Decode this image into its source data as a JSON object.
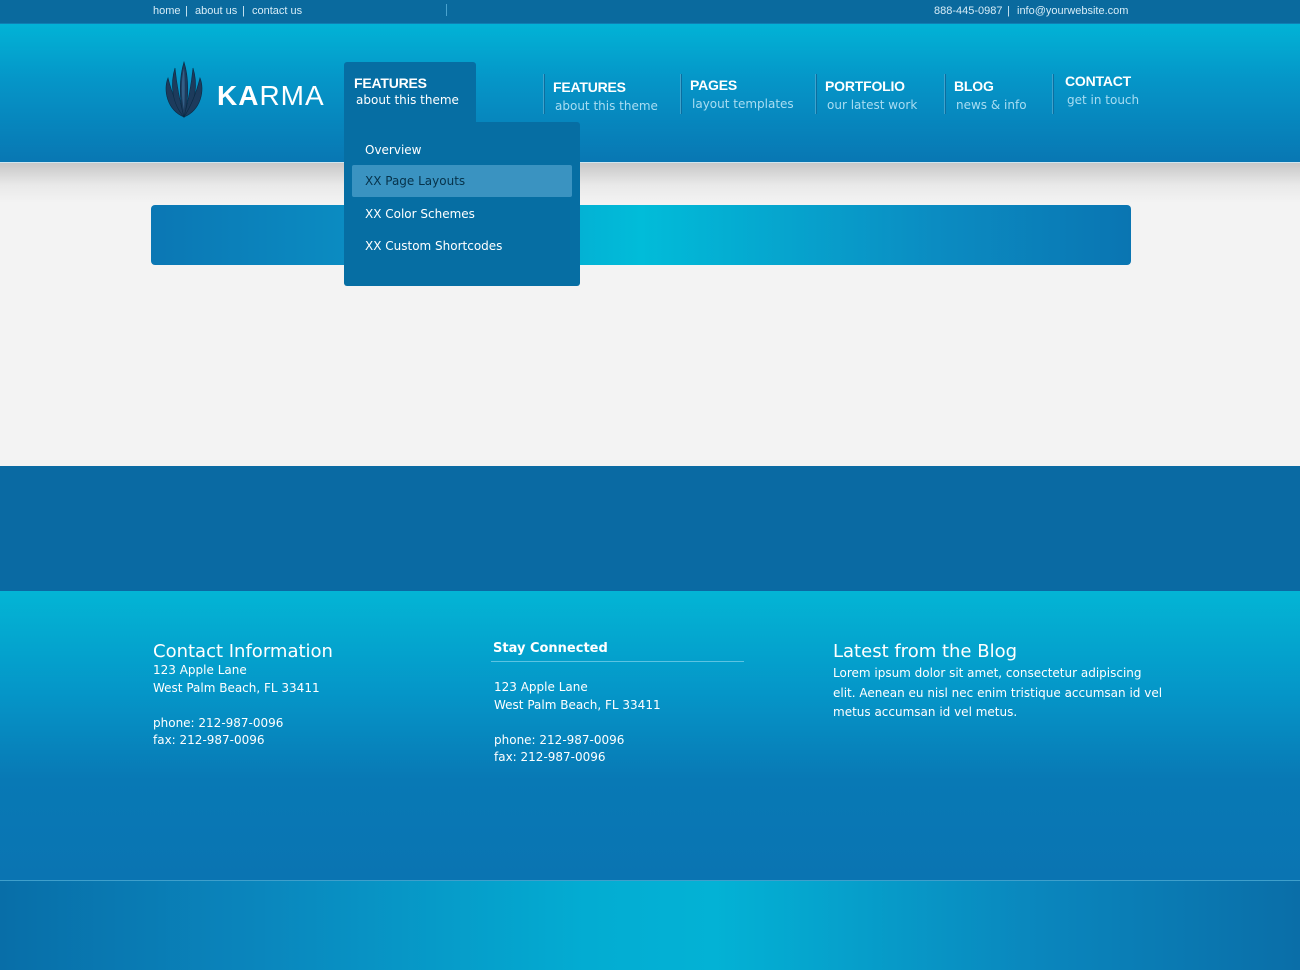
{
  "topbar": {
    "links": [
      "home",
      "about us",
      "contact us"
    ],
    "separator": "|",
    "phone": "888-445-0987",
    "email": "info@yourwebsite.com"
  },
  "logo": {
    "text_bold": "KA",
    "text_light": "RMA"
  },
  "nav": {
    "active": {
      "title": "FEATURES",
      "subtitle": "about this theme"
    },
    "items": [
      {
        "title": "FEATURES",
        "subtitle": "about this theme"
      },
      {
        "title": "PAGES",
        "subtitle": "layout templates"
      },
      {
        "title": "PORTFOLIO",
        "subtitle": "our latest work"
      },
      {
        "title": "BLOG",
        "subtitle": "news & info"
      },
      {
        "title": "CONTACT",
        "subtitle": "get in touch"
      }
    ]
  },
  "dropdown": {
    "items": [
      "Overview",
      "XX Page Layouts",
      "XX Color Schemes",
      "XX Custom Shortcodes"
    ],
    "selected_index": 1
  },
  "footer": {
    "contact": {
      "heading": "Contact Information",
      "address1": "123 Apple Lane",
      "address2": "West Palm Beach, FL 33411",
      "phone": "phone: 212-987-0096",
      "fax": "fax: 212-987-0096"
    },
    "stay": {
      "heading": "Stay Connected",
      "address1": "123 Apple Lane",
      "address2": "West Palm Beach, FL 33411",
      "phone": "phone: 212-987-0096",
      "fax": "fax: 212-987-0096"
    },
    "blog": {
      "heading": "Latest from the Blog",
      "line1": "Lorem ipsum dolor sit amet, consectetur adipiscing",
      "line2": "elit. Aenean eu nisl nec enim tristique accumsan id vel",
      "line3": "metus accumsan id vel metus."
    }
  },
  "colors": {
    "brand_blue": "#0a6aa3",
    "accent_cyan": "#02b3d6"
  }
}
